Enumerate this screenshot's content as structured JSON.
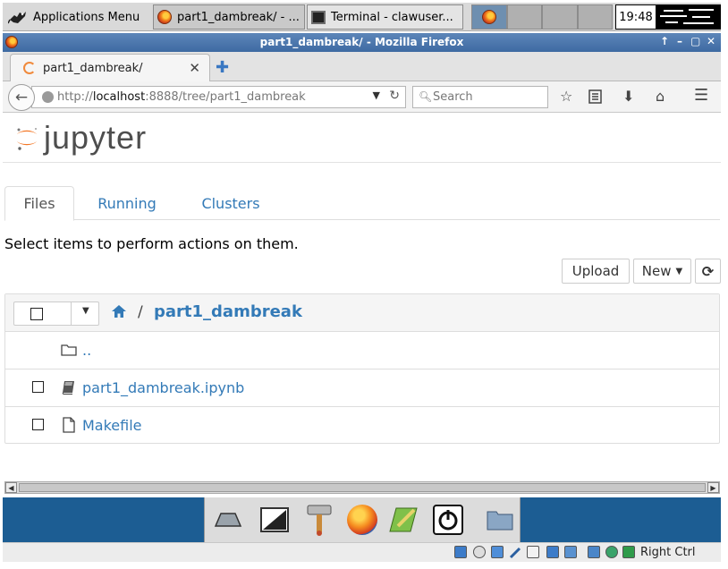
{
  "taskbar": {
    "apps_menu_label": "Applications Menu",
    "tasks": [
      {
        "label": "part1_dambreak/ - ..."
      },
      {
        "label": "Terminal - clawuser..."
      }
    ],
    "clock": "19:48"
  },
  "window": {
    "title": "part1_dambreak/ - Mozilla Firefox",
    "controls": [
      "↑",
      "–",
      "▢",
      "✕"
    ]
  },
  "browser": {
    "tab_title": "part1_dambreak/",
    "tab_close": "✕",
    "new_tab": "✚",
    "url_prefix": "http://",
    "url_host": "localhost",
    "url_rest": ":8888/tree/part1_dambreak",
    "search_placeholder": "Search"
  },
  "jupyter": {
    "logo_word": "jupyter",
    "tabs": [
      {
        "label": "Files",
        "active": true
      },
      {
        "label": "Running",
        "active": false
      },
      {
        "label": "Clusters",
        "active": false
      }
    ],
    "hint": "Select items to perform actions on them.",
    "upload_label": "Upload",
    "new_label": "New",
    "breadcrumb_sep": "/",
    "breadcrumb_dir": "part1_dambreak",
    "rows": [
      {
        "name": "..",
        "icon": "folder-icon",
        "has_checkbox": false
      },
      {
        "name": "part1_dambreak.ipynb",
        "icon": "notebook-icon",
        "has_checkbox": true
      },
      {
        "name": "Makefile",
        "icon": "file-icon",
        "has_checkbox": true
      }
    ]
  },
  "statusbar": {
    "host_key": "Right Ctrl"
  },
  "colors": {
    "link": "#337ab7",
    "titlebar": "#4a76ad",
    "dock": "#1c5d93",
    "jupyter_orange": "#f37726"
  }
}
